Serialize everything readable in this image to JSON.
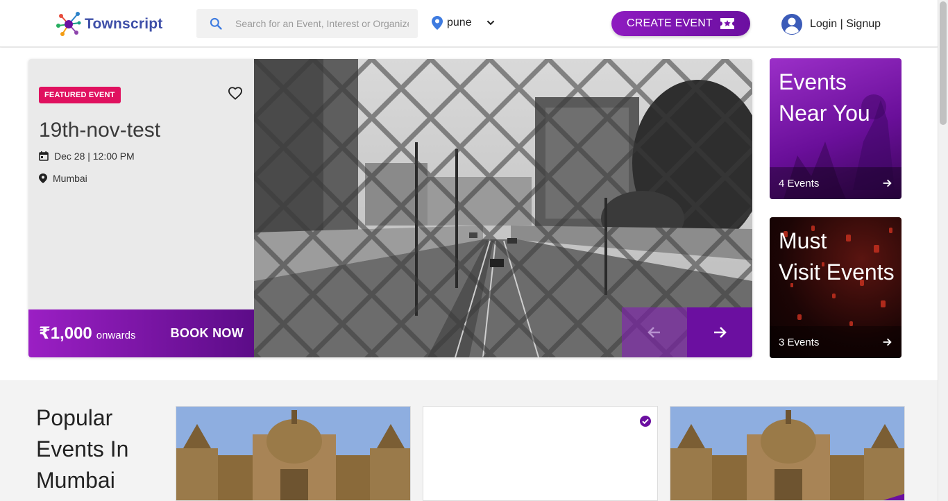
{
  "header": {
    "logo_text": "Townscript",
    "search_placeholder": "Search for an Event, Interest or Organizer",
    "city": "pune",
    "create_event_label": "CREATE EVENT",
    "login_label": "Login | Signup"
  },
  "featured": {
    "badge": "FEATURED EVENT",
    "title": "19th-nov-test",
    "date": "Dec 28 | 12:00 PM",
    "location": "Mumbai",
    "price": "₹1,000",
    "price_suffix": "onwards",
    "book_label": "BOOK NOW"
  },
  "side_cards": [
    {
      "title_line1": "Events",
      "title_line2": "Near You",
      "count": "4 Events"
    },
    {
      "title_line1": "Must",
      "title_line2": "Visit Events",
      "count": "3 Events"
    }
  ],
  "popular": {
    "title_line1": "Popular",
    "title_line2": "Events In",
    "title_line3": "Mumbai"
  },
  "colors": {
    "brand_purple": "#6b0fa0",
    "badge_pink": "#e0115f",
    "logo_blue": "#3e4fa8"
  }
}
